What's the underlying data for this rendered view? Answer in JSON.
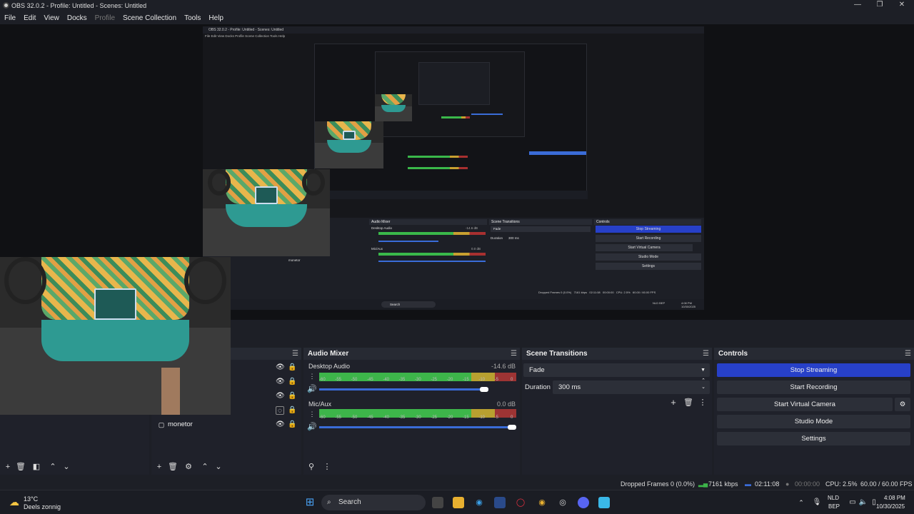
{
  "window": {
    "title": "OBS 32.0.2 - Profile: Untitled - Scenes: Untitled",
    "controls": [
      "—",
      "❐",
      "✕"
    ]
  },
  "menu": [
    "File",
    "Edit",
    "View",
    "Docks",
    "Profile",
    "Scene Collection",
    "Tools",
    "Help"
  ],
  "preview": {
    "inner_title": "OBS 32.0.2 - Profile: Untitled - Scenes: Untitled",
    "inner_menu": "File  Edit  View  Docks  Profile  Scene Collection  Tools  Help",
    "inner_audio_title": "Audio Mixer",
    "inner_transitions_title": "Scene Transitions",
    "inner_controls_title": "Controls",
    "inner_desktop": "Desktop Audio",
    "inner_desktop_db": "-14.6 dB",
    "inner_mic": "Mic/Aux",
    "inner_mic_db": "0.0 dB",
    "inner_fade": "Fade",
    "inner_duration": "Duration",
    "inner_duration_val": "300 ms",
    "inner_buttons": [
      "Stop Streaming",
      "Start Recording",
      "Start Virtual Camera",
      "Studio Mode",
      "Settings"
    ],
    "inner_source": "monetor",
    "inner_status": "Dropped Frames 0 (0.0%)   7161 kbps   02:11:08   00:00:00   CPU: 2.5%   60.00 / 60.00 FPS",
    "inner_search": "Search",
    "inner_tray": "NLD BEP",
    "inner_clock": "4:08 PM 10/30/2025"
  },
  "sources": {
    "items": [
      {
        "label": ""
      },
      {
        "label": ""
      },
      {
        "label": ""
      },
      {
        "label": ""
      },
      {
        "label": "monetor"
      }
    ]
  },
  "audio": {
    "title": "Audio Mixer",
    "ticks": [
      "-60",
      "-55",
      "-50",
      "-45",
      "-40",
      "-35",
      "-30",
      "-25",
      "-20",
      "-15",
      "-10",
      "-5",
      "0"
    ],
    "channels": [
      {
        "name": "Desktop Audio",
        "db": "-14.6 dB",
        "level": 0.76,
        "volume": 0.86
      },
      {
        "name": "Mic/Aux",
        "db": "0.0 dB",
        "level": 0.82,
        "volume": 1.0
      }
    ]
  },
  "transitions": {
    "title": "Scene Transitions",
    "selected": "Fade",
    "duration_label": "Duration",
    "duration_value": "300 ms"
  },
  "controls": {
    "title": "Controls",
    "stop_streaming": "Stop Streaming",
    "start_recording": "Start Recording",
    "start_virtual_camera": "Start Virtual Camera",
    "studio_mode": "Studio Mode",
    "settings": "Settings"
  },
  "status": {
    "dropped": "Dropped Frames 0 (0.0%)",
    "kbps": "7161 kbps",
    "stream_time": "02:11:08",
    "rec_time": "00:00:00",
    "cpu": "CPU: 2.5%",
    "fps": "60.00 / 60.00 FPS"
  },
  "taskbar": {
    "temp": "13°C",
    "weather": "Deels zonnig",
    "search": "Search",
    "lang1": "NLD",
    "lang2": "BEP",
    "time": "4:08 PM",
    "date": "10/30/2025"
  },
  "colors": {
    "accent": "#2740c8",
    "meter_green": "#3db54a",
    "meter_yellow": "#b8a030",
    "meter_red": "#9e3434"
  }
}
